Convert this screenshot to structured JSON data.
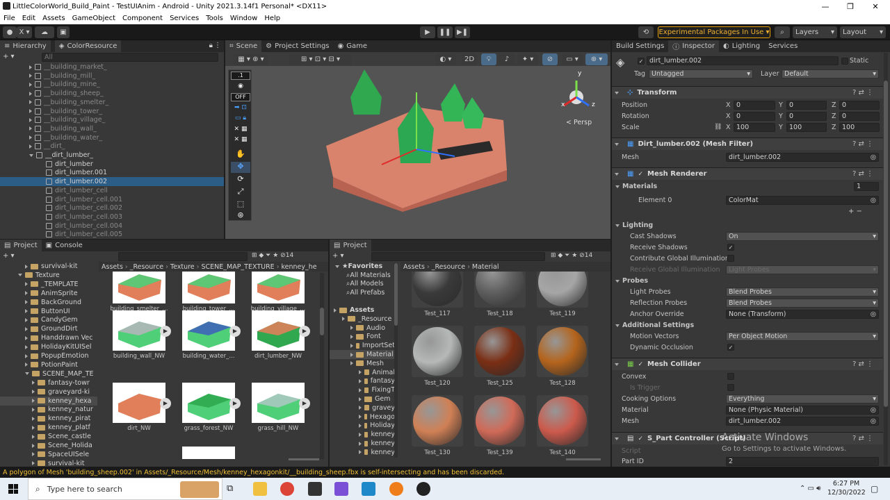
{
  "window": {
    "title": "LittleColorWorld_Build_Paint - TestUIAnim - Android - Unity 2021.3.14f1 Personal* <DX11>",
    "min": "—",
    "max": "❐",
    "close": "✕"
  },
  "menu": [
    "File",
    "Edit",
    "Assets",
    "GameObject",
    "Component",
    "Services",
    "Tools",
    "Window",
    "Help"
  ],
  "toolbar": {
    "account": "X ▾",
    "experimental": "Experimental Packages In Use ▾",
    "layers": "Layers",
    "layout": "Layout"
  },
  "hierarchy": {
    "tabs": [
      "Hierarchy",
      "ColorResource"
    ],
    "search_placeholder": "All",
    "items": [
      {
        "label": "__building_market_",
        "dim": true,
        "indent": 1,
        "expander": true
      },
      {
        "label": "__building_mill_",
        "dim": true,
        "indent": 1,
        "expander": true
      },
      {
        "label": "__building_mine_",
        "dim": true,
        "indent": 1,
        "expander": true
      },
      {
        "label": "__building_sheep_",
        "dim": true,
        "indent": 1,
        "expander": true
      },
      {
        "label": "__building_smelter_",
        "dim": true,
        "indent": 1,
        "expander": true
      },
      {
        "label": "__building_tower_",
        "dim": true,
        "indent": 1,
        "expander": true
      },
      {
        "label": "__building_village_",
        "dim": true,
        "indent": 1,
        "expander": true
      },
      {
        "label": "__building_wall_",
        "dim": true,
        "indent": 1,
        "expander": true
      },
      {
        "label": "__building_water_",
        "dim": true,
        "indent": 1,
        "expander": true
      },
      {
        "label": "__dirt_",
        "dim": true,
        "indent": 1,
        "expander": true
      },
      {
        "label": "__dirt_lumber_",
        "dim": false,
        "indent": 1,
        "expander": true,
        "open": true
      },
      {
        "label": "dirt_lumber",
        "dim": false,
        "indent": 2
      },
      {
        "label": "dirt_lumber.001",
        "dim": false,
        "indent": 2
      },
      {
        "label": "dirt_lumber.002",
        "dim": false,
        "indent": 2,
        "selected": true
      },
      {
        "label": "dirt_lumber_cell",
        "dim": true,
        "indent": 2
      },
      {
        "label": "dirt_lumber_cell.001",
        "dim": true,
        "indent": 2
      },
      {
        "label": "dirt_lumber_cell.002",
        "dim": true,
        "indent": 2
      },
      {
        "label": "dirt_lumber_cell.003",
        "dim": true,
        "indent": 2
      },
      {
        "label": "dirt_lumber_cell.004",
        "dim": true,
        "indent": 2
      },
      {
        "label": "dirt_lumber_cell.005",
        "dim": true,
        "indent": 2
      }
    ]
  },
  "scene": {
    "tabs": [
      "Scene",
      "Project Settings",
      "Game"
    ],
    "mode_2d": "2D",
    "persp": "< Persp",
    "overlay_vals": [
      ".1",
      "OFF"
    ],
    "axis": {
      "x": "x",
      "y": "y",
      "z": "z"
    }
  },
  "project_left": {
    "tabs": [
      "Project",
      "Console"
    ],
    "tree": [
      {
        "label": "survival-kit",
        "indent": 3
      },
      {
        "label": "Texture",
        "indent": 2,
        "open": true
      },
      {
        "label": "_TEMPLATE",
        "indent": 3
      },
      {
        "label": "AnimSprite",
        "indent": 3
      },
      {
        "label": "BackGround",
        "indent": 3
      },
      {
        "label": "ButtonUI",
        "indent": 3
      },
      {
        "label": "CandyGem",
        "indent": 3
      },
      {
        "label": "GroundDirt",
        "indent": 3
      },
      {
        "label": "Handdrawn Vec",
        "indent": 3
      },
      {
        "label": "HolidayKitUISel",
        "indent": 3
      },
      {
        "label": "PopupEmotion",
        "indent": 3
      },
      {
        "label": "PotionPaint",
        "indent": 3
      },
      {
        "label": "SCENE_MAP_TE",
        "indent": 3,
        "open": true
      },
      {
        "label": "fantasy-towr",
        "indent": 4
      },
      {
        "label": "graveyard-ki",
        "indent": 4
      },
      {
        "label": "kenney_hexa",
        "indent": 4,
        "selected": true
      },
      {
        "label": "kenney_natur",
        "indent": 4
      },
      {
        "label": "kenney_pirat",
        "indent": 4
      },
      {
        "label": "kenney_platf",
        "indent": 4
      },
      {
        "label": "Scene_castle",
        "indent": 4
      },
      {
        "label": "Scene_Holida",
        "indent": 4
      },
      {
        "label": "SpaceUISele",
        "indent": 4
      },
      {
        "label": "survival-kit",
        "indent": 4
      }
    ],
    "breadcrumb": [
      "Assets",
      "_Resource",
      "Texture",
      "SCENE_MAP_TEXTURE",
      "kenney_he"
    ],
    "thumbs": [
      {
        "label": "building_smelter_...",
        "kind": "top"
      },
      {
        "label": "building_tower_...",
        "kind": "top"
      },
      {
        "label": "building_village_...",
        "kind": "top"
      },
      {
        "label": "building_wall_NW",
        "kind": "wall"
      },
      {
        "label": "building_water_...",
        "kind": "water"
      },
      {
        "label": "dirt_lumber_NW",
        "kind": "lumber"
      },
      {
        "label": "dirt_NW",
        "kind": "dirt"
      },
      {
        "label": "grass_forest_NW",
        "kind": "forest"
      },
      {
        "label": "grass_hill_NW",
        "kind": "hill"
      }
    ]
  },
  "project_right": {
    "tab": "Project",
    "search_count": "14",
    "favorites": [
      "Favorites",
      "All Materials",
      "All Models",
      "All Prefabs"
    ],
    "tree": [
      {
        "label": "Assets",
        "indent": 0,
        "bold": true
      },
      {
        "label": "_Resource",
        "indent": 1
      },
      {
        "label": "Audio",
        "indent": 2
      },
      {
        "label": "Font",
        "indent": 2
      },
      {
        "label": "ImportSet",
        "indent": 2
      },
      {
        "label": "Material",
        "indent": 2,
        "selected": true
      },
      {
        "label": "Mesh",
        "indent": 2
      },
      {
        "label": "Animal",
        "indent": 3
      },
      {
        "label": "fantasy",
        "indent": 3
      },
      {
        "label": "FixingT",
        "indent": 3
      },
      {
        "label": "Gem",
        "indent": 3
      },
      {
        "label": "gravey",
        "indent": 3
      },
      {
        "label": "Hexago",
        "indent": 3
      },
      {
        "label": "Holiday",
        "indent": 3
      },
      {
        "label": "kenney",
        "indent": 3
      },
      {
        "label": "kenney",
        "indent": 3
      },
      {
        "label": "kenney",
        "indent": 3
      }
    ],
    "breadcrumb": [
      "Assets",
      "_Resource",
      "Material"
    ],
    "materials": [
      {
        "label": "Test_117",
        "color": "#3a3a3a"
      },
      {
        "label": "Test_118",
        "color": "#5e5e5e"
      },
      {
        "label": "Test_119",
        "color": "#a6a6a6"
      },
      {
        "label": "Test_120",
        "color": "#b4b8b6"
      },
      {
        "label": "Test_125",
        "color": "#7a2e14"
      },
      {
        "label": "Test_128",
        "color": "#b4641c"
      },
      {
        "label": "Test_130",
        "color": "#d08055"
      },
      {
        "label": "Test_139",
        "color": "#d06a58"
      },
      {
        "label": "Test_140",
        "color": "#cc5a4c"
      }
    ]
  },
  "inspector": {
    "tabs": [
      "Build Settings",
      "Inspector",
      "Lighting",
      "Services"
    ],
    "object_name": "dirt_lumber.002",
    "static_label": "Static",
    "tag_label": "Tag",
    "tag_value": "Untagged",
    "layer_label": "Layer",
    "layer_value": "Default",
    "transform": {
      "title": "Transform",
      "rows": [
        {
          "label": "Position",
          "x": "0",
          "y": "0",
          "z": "0"
        },
        {
          "label": "Rotation",
          "x": "0",
          "y": "0",
          "z": "0"
        },
        {
          "label": "Scale",
          "x": "100",
          "y": "100",
          "z": "100"
        }
      ],
      "axes": [
        "X",
        "Y",
        "Z"
      ]
    },
    "mesh_filter": {
      "title": "Dirt_lumber.002 (Mesh Filter)",
      "mesh_label": "Mesh",
      "mesh_value": "dirt_lumber.002"
    },
    "mesh_renderer": {
      "title": "Mesh Renderer",
      "materials_label": "Materials",
      "materials_count": "1",
      "element_label": "Element 0",
      "element_value": "ColorMat",
      "lighting_label": "Lighting",
      "cast_shadows_label": "Cast Shadows",
      "cast_shadows_value": "On",
      "receive_shadows_label": "Receive Shadows",
      "contribute_gi_label": "Contribute Global Illumination",
      "receive_gi_label": "Receive Global Illumination",
      "receive_gi_value": "Light Probes",
      "probes_label": "Probes",
      "light_probes_label": "Light Probes",
      "light_probes_value": "Blend Probes",
      "reflection_probes_label": "Reflection Probes",
      "reflection_probes_value": "Blend Probes",
      "anchor_label": "Anchor Override",
      "anchor_value": "None (Transform)",
      "additional_label": "Additional Settings",
      "motion_label": "Motion Vectors",
      "motion_value": "Per Object Motion",
      "dynamic_label": "Dynamic Occlusion"
    },
    "mesh_collider": {
      "title": "Mesh Collider",
      "convex_label": "Convex",
      "trigger_label": "Is Trigger",
      "cooking_label": "Cooking Options",
      "cooking_value": "Everything",
      "material_label": "Material",
      "material_value": "None (Physic Material)",
      "mesh_label": "Mesh",
      "mesh_value": "dirt_lumber.002"
    },
    "part_controller": {
      "title": "S_Part Controller (Script)",
      "script_label": "Script",
      "partid_label": "Part ID",
      "partid_value": "2"
    }
  },
  "status_message": "A polygon of Mesh 'building_sheep.002' in Assets/_Resource/Mesh/kenney_hexagonkit/__building_sheep.fbx is self-intersecting and has been discarded.",
  "watermark": {
    "line1": "Activate Windows",
    "line2": "Go to Settings to activate Windows."
  },
  "taskbar": {
    "search": "Type here to search",
    "time": "6:27 PM",
    "date": "12/30/2022"
  },
  "colors": {
    "accent_selected": "#2c5d87",
    "experimental_border": "#e8a000",
    "status_warning": "#f2c036"
  }
}
